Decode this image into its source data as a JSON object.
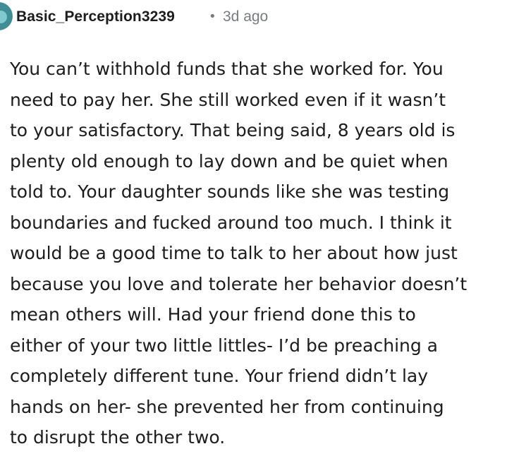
{
  "comment": {
    "author": "Basic_Perception3239",
    "separator": "•",
    "time_ago": "3d ago",
    "avatar_icon": "user-avatar-icon",
    "body_lines": [
      "You can’t withhold funds that she worked for. You",
      "need to pay her. She still worked even if it wasn’t",
      "to your satisfactory. That being said, 8 years old is",
      "plenty old enough to lay down and be quiet when",
      "told to. Your daughter sounds like she was testing",
      "boundaries and fucked around too much. I think it",
      "would be a good time to talk to her about how just",
      "because you love and tolerate her behavior doesn’t",
      "mean others will. Had your friend done this to",
      "either of your two little littles- I’d be preaching a",
      "completely different tune. Your friend didn’t lay",
      "hands on her- she prevented her from continuing",
      "to disrupt the other two."
    ]
  },
  "colors": {
    "text": "#1c1c1c",
    "meta": "#787c7e",
    "avatar": "#3e8e96"
  }
}
